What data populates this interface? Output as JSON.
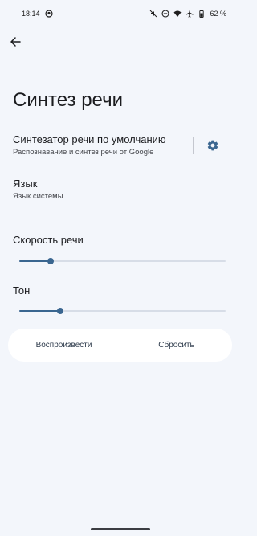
{
  "status_bar": {
    "time": "18:14",
    "battery": "62 %",
    "icons": [
      "chat-bubble-icon",
      "mute-icon",
      "do-not-disturb-icon",
      "wifi-icon",
      "airplane-icon",
      "battery-icon"
    ]
  },
  "header": {
    "back_icon": "arrow-back-icon",
    "title": "Синтез речи"
  },
  "engine": {
    "title": "Синтезатор речи по умолчанию",
    "subtitle": "Распознавание и синтез речи от Google",
    "settings_icon": "gear-icon"
  },
  "language": {
    "title": "Язык",
    "subtitle": "Язык системы"
  },
  "speech_rate": {
    "label": "Скорость речи",
    "value": 0.15
  },
  "pitch": {
    "label": "Тон",
    "value": 0.2
  },
  "actions": {
    "play_label": "Воспроизвести",
    "reset_label": "Сбросить"
  },
  "colors": {
    "background": "#f3f6fb",
    "accent": "#3a6690",
    "track": "#d7dde7",
    "button_bg": "#ffffff"
  }
}
